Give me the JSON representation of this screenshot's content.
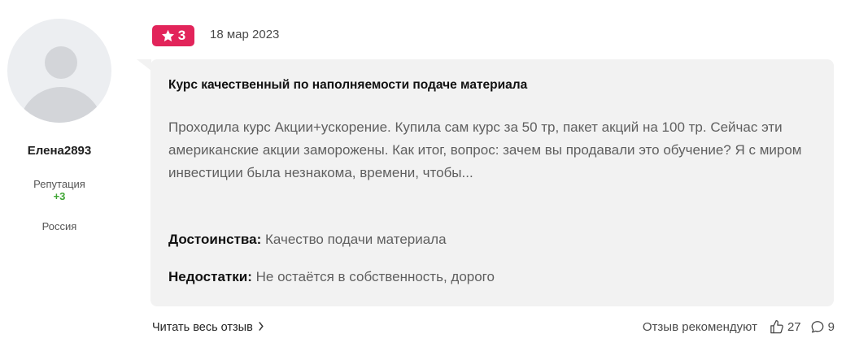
{
  "author": {
    "name": "Елена2893",
    "reputation_label": "Репутация",
    "reputation_value": "+3",
    "country": "Россия"
  },
  "review": {
    "rating": "3",
    "date": "18 мар 2023",
    "title": "Курс качественный по наполняемости подаче материала",
    "body": "Проходила курс Акции+ускорение. Купила сам курс за 50 тр, пакет акций на 100 тр. Сейчас эти американские акции заморожены. Как итог, вопрос: зачем вы продавали это обучение? Я с миром инвестиции была незнакома, времени, чтобы...",
    "pros_label": "Достоинства:",
    "pros_text": "Качество подачи материала",
    "cons_label": "Недостатки:",
    "cons_text": "Не остаётся в собственность, дорого"
  },
  "footer": {
    "read_more_label": "Читать весь отзыв",
    "recommend_label": "Отзыв рекомендуют",
    "likes_count": "27",
    "comments_count": "9"
  },
  "colors": {
    "rating_badge": "#e2245a",
    "reputation_positive": "#3fa534",
    "bubble_background": "#f2f2f2"
  },
  "icons": {
    "rating": "star-icon",
    "read_more": "chevron-right-icon",
    "likes": "thumbs-up-icon",
    "comments": "comment-icon"
  }
}
